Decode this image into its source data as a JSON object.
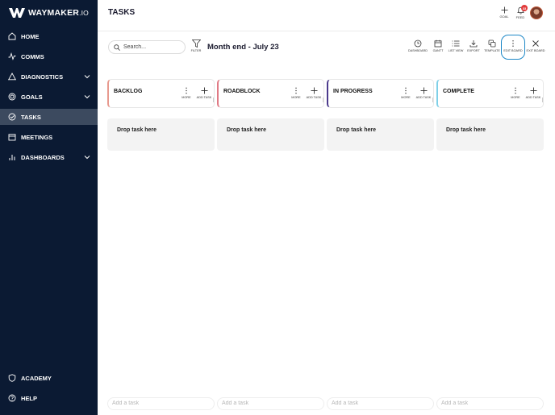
{
  "brand": {
    "name": "WAYMAKER",
    "suffix": ".IO"
  },
  "sidebar": {
    "items": [
      {
        "label": "HOME",
        "icon": "home-icon"
      },
      {
        "label": "COMMS",
        "icon": "pulse-icon"
      },
      {
        "label": "DIAGNOSTICS",
        "icon": "triangle-icon",
        "expandable": true
      },
      {
        "label": "GOALS",
        "icon": "target-icon",
        "expandable": true
      },
      {
        "label": "TASKS",
        "icon": "check-circle-icon",
        "active": true
      },
      {
        "label": "MEETINGS",
        "icon": "calendar-icon"
      },
      {
        "label": "DASHBOARDS",
        "icon": "bar-chart-icon",
        "expandable": true
      }
    ],
    "bottom": [
      {
        "label": "ACADEMY",
        "icon": "shield-icon"
      },
      {
        "label": "HELP",
        "icon": "help-icon"
      }
    ]
  },
  "header": {
    "title": "TASKS",
    "goal_label": "GOAL",
    "feed_label": "FEED",
    "feed_badge": "33"
  },
  "toolbar": {
    "search_placeholder": "Search...",
    "filter_label": "FILTER",
    "board_title": "Month end - July 23",
    "tools": [
      {
        "label": "DASHBOARD",
        "icon": "clock-icon"
      },
      {
        "label": "GANTT",
        "icon": "calendar-icon"
      },
      {
        "label": "LIST VIEW",
        "icon": "list-icon"
      },
      {
        "label": "EXPORT",
        "icon": "download-icon"
      },
      {
        "label": "TEMPLATE",
        "icon": "copy-icon"
      },
      {
        "label": "EDIT BOARD",
        "icon": "more-vertical-icon"
      },
      {
        "label": "EXIT BOARD",
        "icon": "close-icon"
      }
    ]
  },
  "board": {
    "columns": [
      {
        "name": "BACKLOG",
        "color": "#e89a8f"
      },
      {
        "name": "ROADBLOCK",
        "color": "#e07a85"
      },
      {
        "name": "IN PROGRESS",
        "color": "#4b3a8c"
      },
      {
        "name": "COMPLETE",
        "color": "#7fd0e8"
      }
    ],
    "more_label": "MORE",
    "add_task_label": "ADD TASK",
    "drop_text": "Drop task here",
    "add_task_placeholder": "Add a task"
  },
  "colors": {
    "sidebar_bg": "#0b1a33",
    "active_item": "#3c4a5f",
    "accent": "#1e88c7",
    "badge": "#e23a3a"
  }
}
